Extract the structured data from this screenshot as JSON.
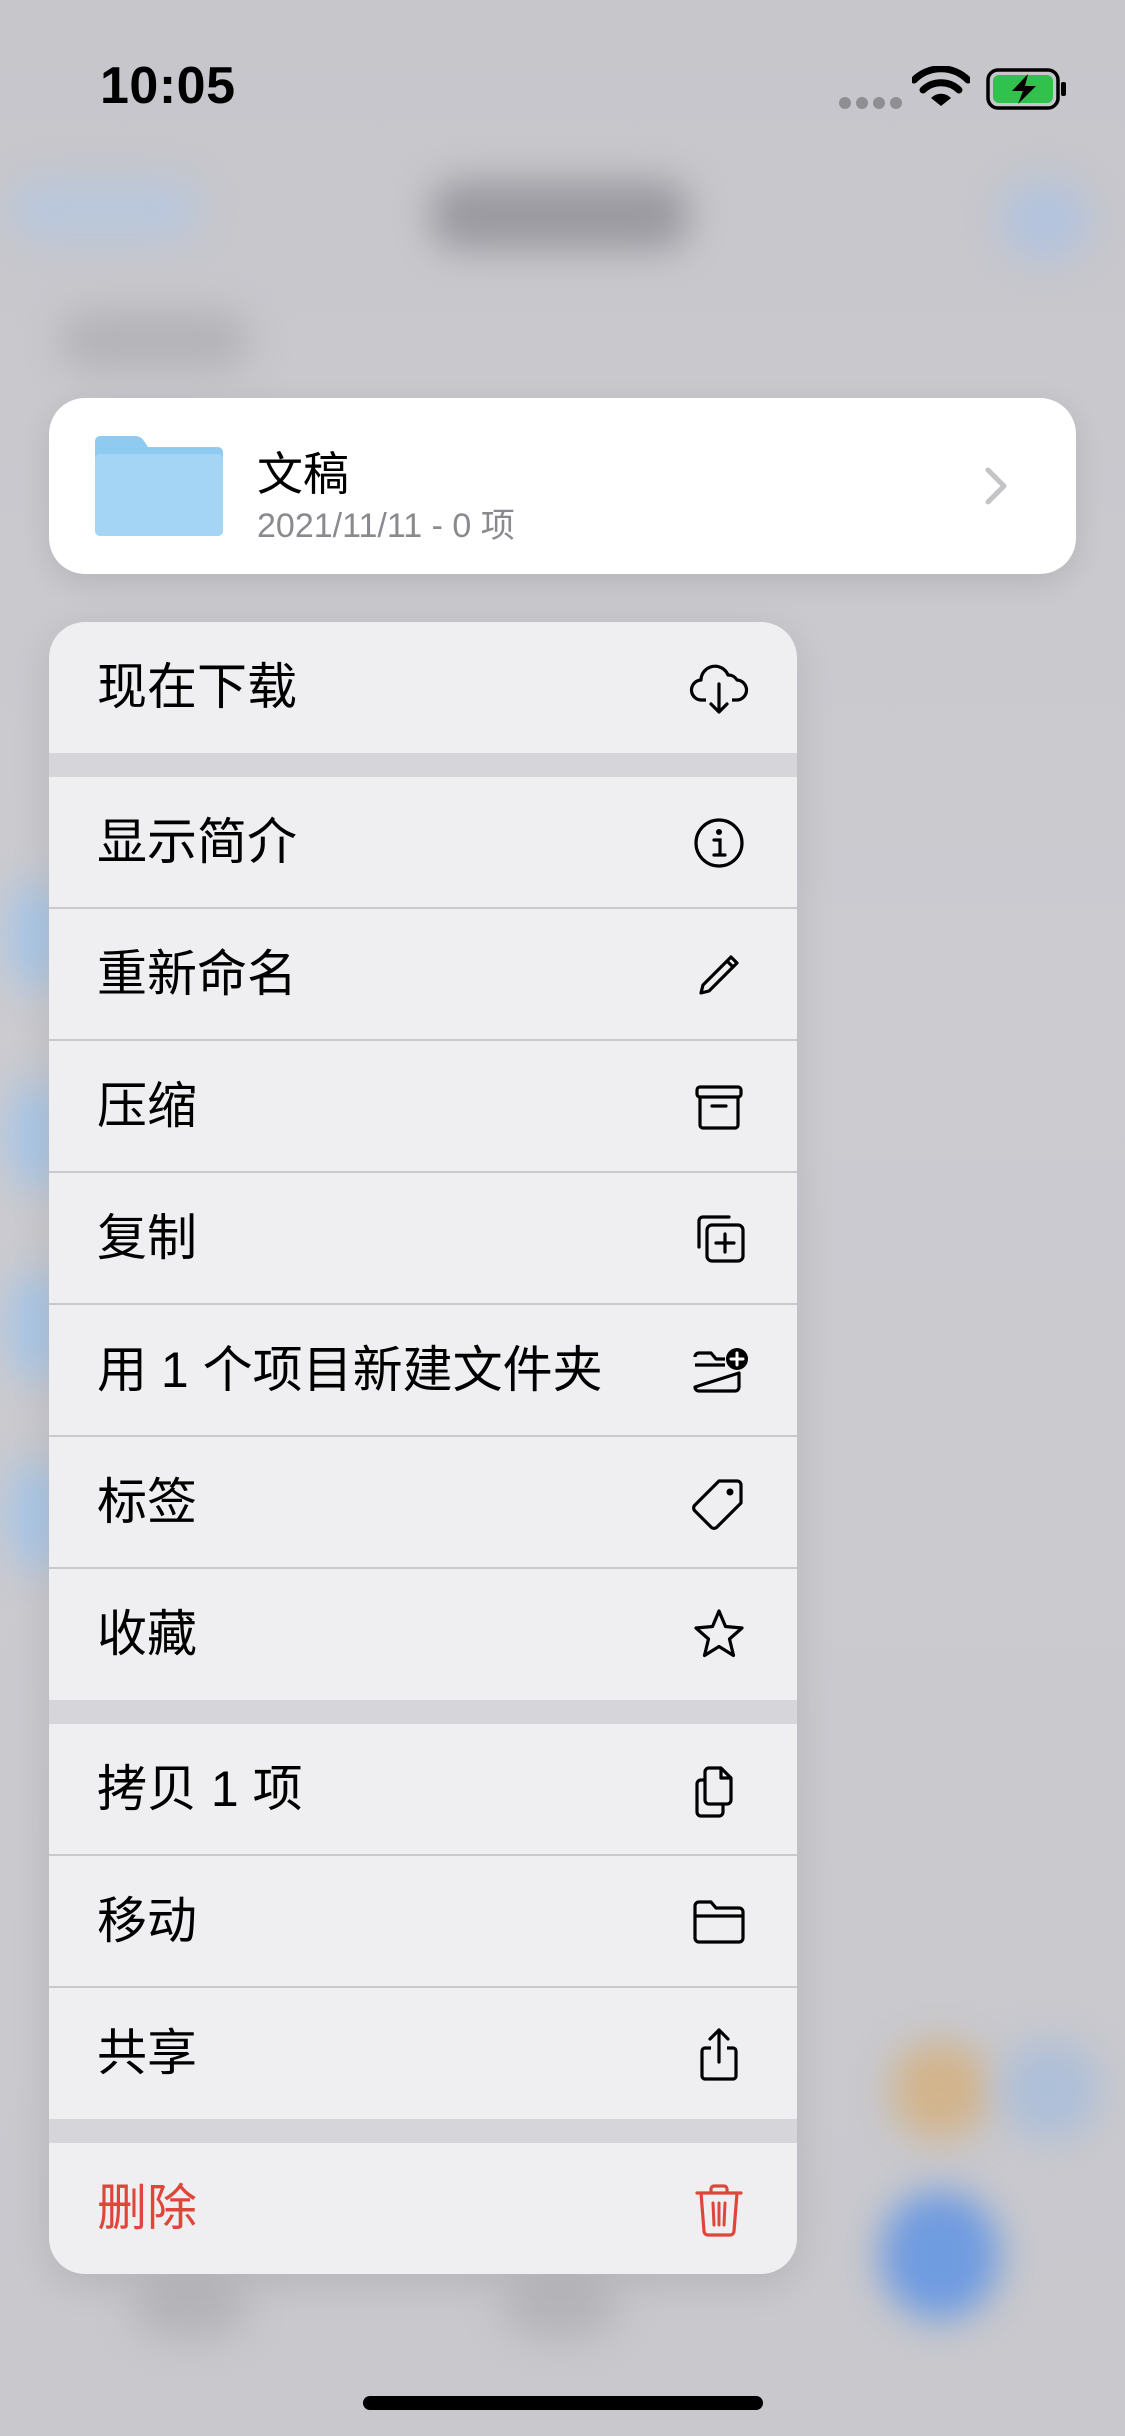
{
  "status_bar": {
    "time": "10:05"
  },
  "preview": {
    "title": "文稿",
    "subtitle": "2021/11/11 - 0 项",
    "folder_color": "#8ccaf2"
  },
  "menu": {
    "groups": [
      {
        "items": [
          {
            "label": "现在下载",
            "icon": "cloud-download-icon"
          }
        ]
      },
      {
        "items": [
          {
            "label": "显示简介",
            "icon": "info-icon"
          },
          {
            "label": "重新命名",
            "icon": "pencil-icon"
          },
          {
            "label": "压缩",
            "icon": "archive-box-icon"
          },
          {
            "label": "复制",
            "icon": "duplicate-icon"
          },
          {
            "label": "用 1 个项目新建文件夹",
            "icon": "folder-badge-plus-icon"
          },
          {
            "label": "标签",
            "icon": "tag-icon"
          },
          {
            "label": "收藏",
            "icon": "star-icon"
          }
        ]
      },
      {
        "items": [
          {
            "label": "拷贝 1 项",
            "icon": "copy-docs-icon"
          },
          {
            "label": "移动",
            "icon": "folder-icon"
          },
          {
            "label": "共享",
            "icon": "share-icon"
          }
        ]
      },
      {
        "items": [
          {
            "label": "删除",
            "icon": "trash-icon",
            "destructive": true
          }
        ]
      }
    ]
  },
  "colors": {
    "destructive": "#e0453a",
    "accent": "#007aff"
  }
}
